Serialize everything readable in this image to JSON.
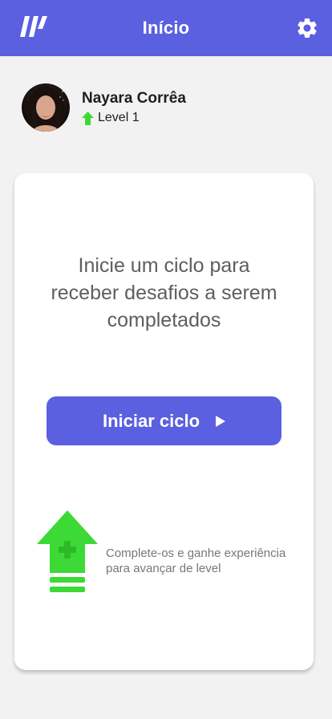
{
  "header": {
    "title": "Início",
    "logo_icon": "logo-icon",
    "settings_icon": "gear-icon"
  },
  "profile": {
    "name": "Nayara Corrêa",
    "level_label": "Level 1",
    "level_icon": "arrow-up-icon"
  },
  "card": {
    "message": "Inicie um ciclo para receber desafios a serem completados",
    "start_button_label": "Iniciar ciclo",
    "start_button_icon": "play-icon",
    "xp_icon": "level-up-arrow-icon",
    "hint": "Complete-os e ganhe experiência para avançar de level"
  },
  "colors": {
    "primary": "#5a60e0",
    "accent_green": "#3dd936",
    "background": "#f2f2f2"
  }
}
